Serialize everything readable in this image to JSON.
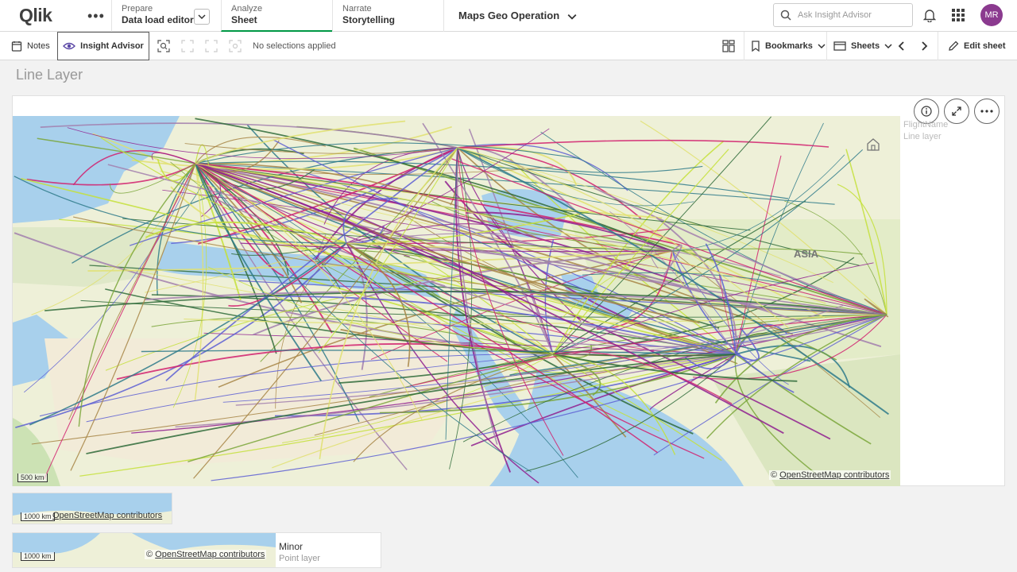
{
  "nav": {
    "logo": "Qlik",
    "prepare_label": "Prepare",
    "prepare_value": "Data load editor",
    "analyze_label": "Analyze",
    "analyze_value": "Sheet",
    "narrate_label": "Narrate",
    "narrate_value": "Storytelling",
    "app_title": "Maps Geo Operation",
    "search_placeholder": "Ask Insight Advisor",
    "avatar_initials": "MR"
  },
  "toolbar": {
    "notes": "Notes",
    "insight": "Insight Advisor",
    "no_selections": "No selections applied",
    "bookmarks": "Bookmarks",
    "sheets": "Sheets",
    "edit_sheet": "Edit sheet"
  },
  "sheet": {
    "title": "Line Layer"
  },
  "map": {
    "legend_title": "FlightName",
    "legend_sub": "Line layer",
    "region_label": "ASIA",
    "scale": "500 km",
    "attribution_prefix": "©",
    "attribution_link": "OpenStreetMap contributors"
  },
  "mini1": {
    "scale": "1000 km",
    "attribution_link": "OpenStreetMap contributors"
  },
  "mini2": {
    "scale": "1000 km",
    "attribution_prefix": "©",
    "attribution_link": "OpenStreetMap contributors",
    "legend_title": "Minor",
    "legend_sub": "Point layer"
  },
  "colors": {
    "accent": "#009845",
    "avatar": "#8b3a8f",
    "route_colors": [
      "#c4e03a",
      "#a78545",
      "#2f6b3a",
      "#8f1f8f",
      "#a27fae",
      "#d1206e",
      "#5d5fd3",
      "#2e7a8a",
      "#7aa63a",
      "#e0e070"
    ]
  }
}
